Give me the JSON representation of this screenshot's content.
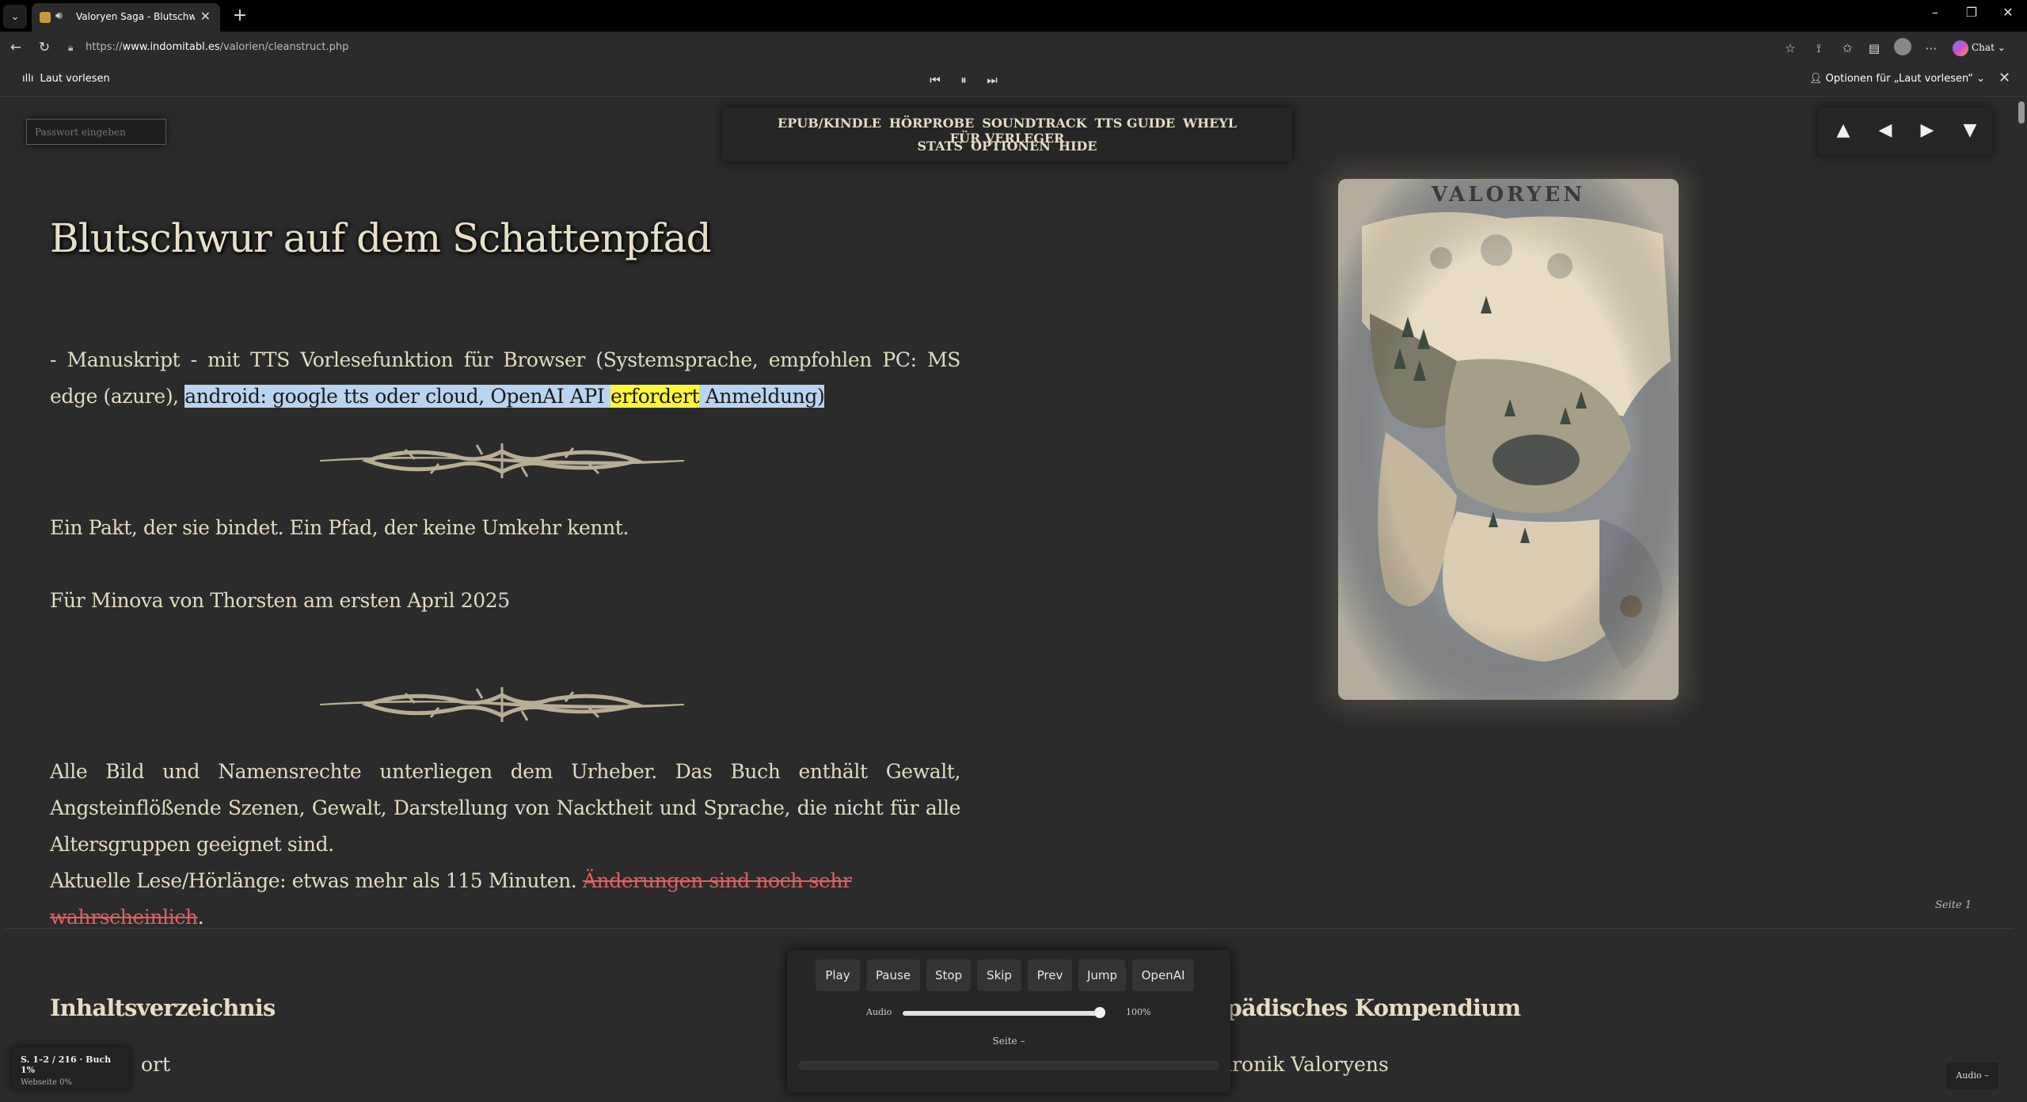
{
  "browser": {
    "tab_title": "Valoryen Saga - Blutschwur a",
    "url_prefix": "https://",
    "url_domain": "www.indomitabl.es",
    "url_path": "/valorien/cleanstruct.php",
    "copilot_label": "Chat"
  },
  "read_aloud": {
    "label": "Laut vorlesen",
    "options_label": "Optionen für „Laut vorlesen“"
  },
  "page": {
    "password_placeholder": "Passwort eingeben",
    "nav_row1": [
      "EPUB/KINDLE",
      "HÖRPROBE",
      "SOUNDTRACK",
      "TTS GUIDE",
      "WHEYL",
      "FÜR VERLEGER"
    ],
    "nav_row2": [
      "STATS",
      "OPTIONEN",
      "HIDE"
    ],
    "arrows": [
      "▲",
      "◀",
      "▶",
      "▼"
    ],
    "title": "Blutschwur auf dem Schattenpfad",
    "intro_part1": "- Manuskript - mit TTS Vorlesefunktion für Browser (Systemsprache, empfohlen PC: MS edge (azure), ",
    "intro_sel1": "android: google tts oder cloud, OpenAI API ",
    "intro_highlight": "erfordert",
    "intro_sel2": " Anmeldung)",
    "pakt": "Ein Pakt, der sie bindet. Ein Pfad, der keine Umkehr kennt.",
    "dedication": "Für Minova von Thorsten am ersten April 2025",
    "rights_line1": "Alle Bild und Namensrechte unterliegen dem Urheber. Das Buch enthält Gewalt, Angsteinflößende Szenen, Gewalt, Darstellung von Nacktheit und Sprache, die nicht für alle Altersgruppen geeignet sind.",
    "rights_line2": "Aktuelle Lese/Hörlänge: etwas mehr als 115 Minuten. ",
    "rights_strike": "Änderungen sind noch sehr wahrscheinlich",
    "rights_end": ".",
    "map_label": "VALORYEN",
    "page_label": "Seite 1",
    "toc_heading": "Inhaltsverzeichnis",
    "toc_item_partial": "ort",
    "compendium_heading": "opädisches Kompendium",
    "compendium_item_partial": "hronik Valoryens"
  },
  "player": {
    "buttons": [
      "Play",
      "Pause",
      "Stop",
      "Skip",
      "Prev",
      "Jump",
      "OpenAI"
    ],
    "audio_label": "Audio",
    "volume_percent": "100%",
    "volume_value": 1.0,
    "page_indicator": "Seite –"
  },
  "status": {
    "line1": "S. 1–2 / 216 · Buch 1%",
    "line2": "Webseite 0%",
    "audio_badge": "Audio –"
  }
}
